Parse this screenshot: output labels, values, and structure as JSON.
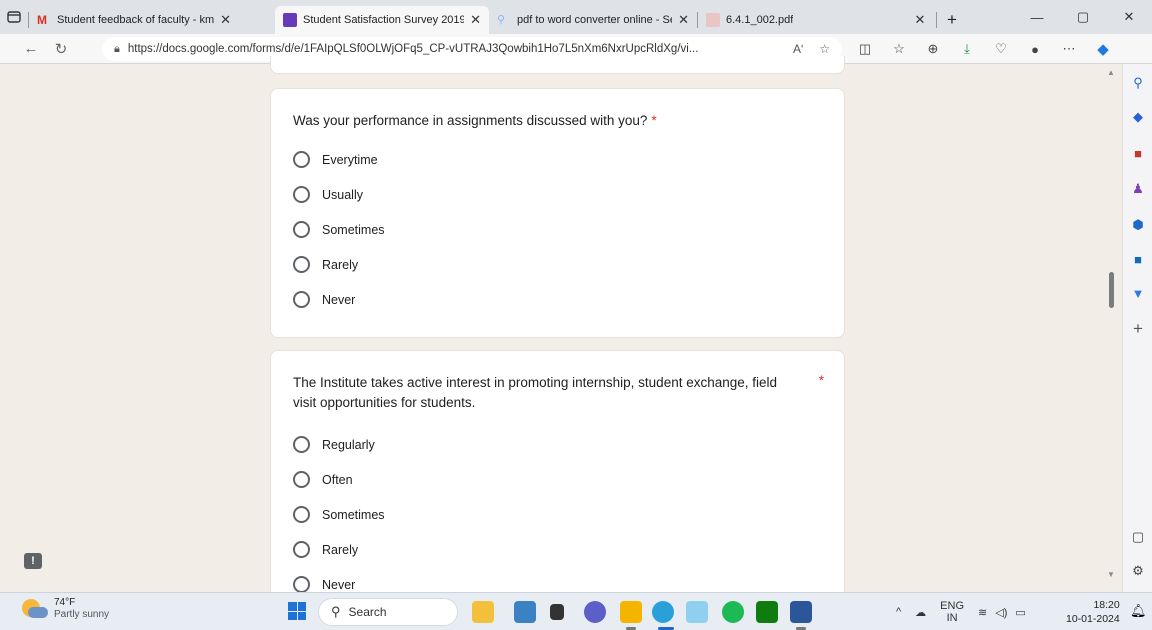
{
  "browser": {
    "tabs": [
      {
        "label": "Student feedback of faculty - km",
        "icon": "gmail-icon",
        "color": "#d93025"
      },
      {
        "label": "Student Satisfaction Survey 2019",
        "icon": "forms-icon",
        "color": "#673ab7"
      },
      {
        "label": "pdf to word converter online - Se",
        "icon": "search-icon",
        "color": "#8ab4f8"
      },
      {
        "label": "6.4.1_002.pdf",
        "icon": "pdf-icon",
        "color": "#c4302b"
      }
    ],
    "url": "https://docs.google.com/forms/d/e/1FAIpQLSf0OLWjOFq5_CP-vUTRAJ3Qowbih1Ho7L5nXm6NxrUpcRldXg/vi...",
    "read_aloud": "Aʹ"
  },
  "form": {
    "q1": {
      "title": "Was your performance in assignments discussed with you?",
      "required_mark": "*",
      "options": [
        "Everytime",
        "Usually",
        "Sometimes",
        "Rarely",
        "Never"
      ]
    },
    "q2": {
      "title": "The Institute takes active interest in promoting internship, student exchange, field visit opportunities for students.",
      "required_mark": "*",
      "options": [
        "Regularly",
        "Often",
        "Sometimes",
        "Rarely",
        "Never"
      ]
    }
  },
  "taskbar": {
    "weather_temp": "74°F",
    "weather_cond": "Partly sunny",
    "search_placeholder": "Search",
    "lang_top": "ENG",
    "lang_bottom": "IN",
    "time": "18:20",
    "date": "10-01-2024"
  },
  "colors": {
    "background": "#f2ede6",
    "required": "#d93025",
    "accent": "#673ab7"
  }
}
